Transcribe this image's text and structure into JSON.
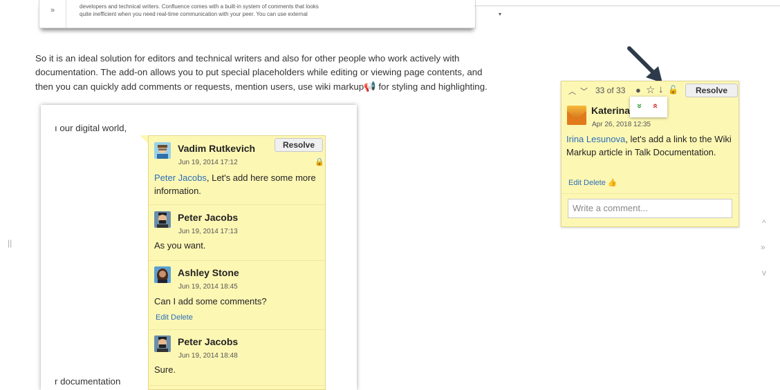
{
  "top_excerpt": {
    "gutter": "»",
    "lines": [
      "developers and technical writers. Confluence comes with a built-in system of comments that looks",
      "quite inefficient when you need real-time communication with your peer. You can use external"
    ]
  },
  "paragraph": {
    "line1": "So it is an ideal solution for editors and technical writers and also for other people who work actively with",
    "line2": "documentation. The add-on allows you to put special placeholders while editing or viewing page contents, and",
    "line3a": "then you can quickly add comments or requests, mention users, use wiki markup",
    "line3b": " for styling and highlighting."
  },
  "card_fragments": {
    "top": "ı our digital world,",
    "bottom": "r documentation"
  },
  "thread": {
    "resolve_label": "Resolve",
    "comments": [
      {
        "author": "Vadim Rutkevich",
        "date": "Jun 19, 2014 17:12",
        "mention": "Peter Jacobs",
        "text": ", Let's add here some more information.",
        "avatar": "avatar-vadim"
      },
      {
        "author": "Peter Jacobs",
        "date": "Jun 19, 2014 17:13",
        "text": "As you want.",
        "avatar": "avatar-peter"
      },
      {
        "author": "Ashley Stone",
        "date": "Jun 19, 2014 18:45",
        "text": "Can I add some comments?",
        "edit": "Edit",
        "delete": "Delete",
        "avatar": "avatar-ashley"
      },
      {
        "author": "Peter Jacobs",
        "date": "Jun 19, 2014 18:48",
        "text": "Sure.",
        "avatar": "avatar-peter"
      }
    ]
  },
  "panel": {
    "counter": "33 of 33",
    "resolve_label": "Resolve",
    "author": "Katerina",
    "date": "Apr 26, 2018 12:35",
    "mention": "Irina Lesunova",
    "text": ", let's add a link to the Wiki Markup article in Talk Documentation.",
    "edit": "Edit",
    "delete": "Delete",
    "write_placeholder": "Write a comment...",
    "popup_down": "»",
    "popup_up": "»"
  },
  "side_controls": {
    "up": "^",
    "next": "»",
    "down": "v",
    "left": "||"
  },
  "colors": {
    "note": "#fdf7b4",
    "link": "#2a6ebb",
    "arrow": "#2d3a4a"
  }
}
